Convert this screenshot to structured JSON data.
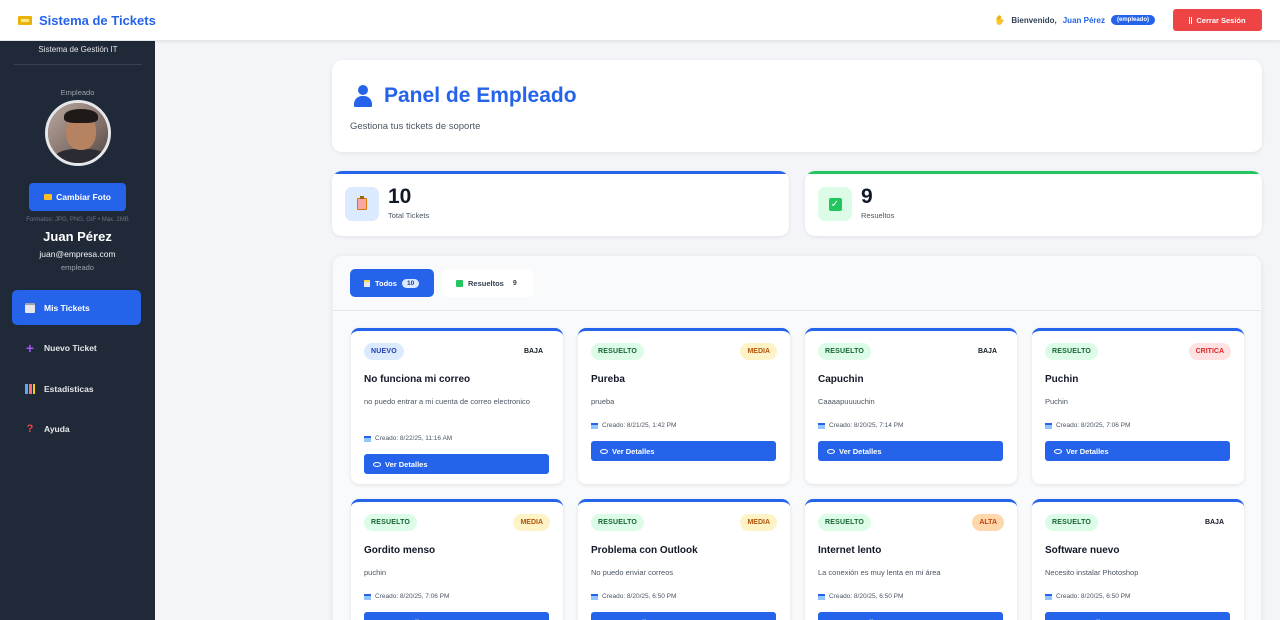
{
  "topbar": {
    "title": "Sistema de Tickets",
    "welcome": "Bienvenido,",
    "username": "Juan Pérez",
    "role_badge": "(empleado)",
    "logout": "Cerrar Sesión"
  },
  "sidebar": {
    "subtitle": "Sistema de Gestión IT",
    "role_label": "Empleado",
    "change_photo": "Cambiar Foto",
    "formats": "Formatos: JPG, PNG, GIF • Máx. 2MB",
    "name": "Juan Pérez",
    "email": "juan@empresa.com",
    "role": "empleado",
    "items": [
      {
        "label": "Mis Tickets",
        "icon": "clipboard-icon"
      },
      {
        "label": "Nuevo Ticket",
        "icon": "plus-icon"
      },
      {
        "label": "Estadísticas",
        "icon": "bar-chart-icon"
      },
      {
        "label": "Ayuda",
        "icon": "question-icon"
      }
    ]
  },
  "header": {
    "title": "Panel de Empleado",
    "subtitle": "Gestiona tus tickets de soporte"
  },
  "stats": {
    "total_value": "10",
    "total_label": "Total Tickets",
    "resolved_value": "9",
    "resolved_label": "Resueltos"
  },
  "filters": {
    "all_label": "Todos",
    "all_count": "10",
    "resolved_label": "Resueltos",
    "resolved_count": "9"
  },
  "tickets": [
    {
      "status": "NUEVO",
      "priority": "BAJA",
      "title": "No funciona mi correo",
      "desc": "no puedo entrar a mi cuenta de correo electronico",
      "date": "Creado: 8/22/25, 11:16 AM",
      "button": "Ver Detalles"
    },
    {
      "status": "RESUELTO",
      "priority": "MEDIA",
      "title": "Pureba",
      "desc": "prueba",
      "date": "Creado: 8/21/25, 1:42 PM",
      "button": "Ver Detalles"
    },
    {
      "status": "RESUELTO",
      "priority": "BAJA",
      "title": "Capuchin",
      "desc": "Caaaapuuuuchin",
      "date": "Creado: 8/20/25, 7:14 PM",
      "button": "Ver Detalles"
    },
    {
      "status": "RESUELTO",
      "priority": "CRITICA",
      "title": "Puchin",
      "desc": "Puchin",
      "date": "Creado: 8/20/25, 7:06 PM",
      "button": "Ver Detalles"
    },
    {
      "status": "RESUELTO",
      "priority": "MEDIA",
      "title": "Gordito menso",
      "desc": "puchin",
      "date": "Creado: 8/20/25, 7:06 PM",
      "button": "Ver Detalles"
    },
    {
      "status": "RESUELTO",
      "priority": "MEDIA",
      "title": "Problema con Outlook",
      "desc": "No puedo enviar correos",
      "date": "Creado: 8/20/25, 6:50 PM",
      "button": "Ver Detalles"
    },
    {
      "status": "RESUELTO",
      "priority": "ALTA",
      "title": "Internet lento",
      "desc": "La conexión es muy lenta en mi área",
      "date": "Creado: 8/20/25, 6:50 PM",
      "button": "Ver Detalles"
    },
    {
      "status": "RESUELTO",
      "priority": "BAJA",
      "title": "Software nuevo",
      "desc": "Necesito instalar Photoshop",
      "date": "Creado: 8/20/25, 6:50 PM",
      "button": "Ver Detalles"
    }
  ],
  "colors": {
    "accent": "#2563eb",
    "sidebar": "#1f2937",
    "danger": "#ef4444",
    "success": "#22c55e"
  }
}
